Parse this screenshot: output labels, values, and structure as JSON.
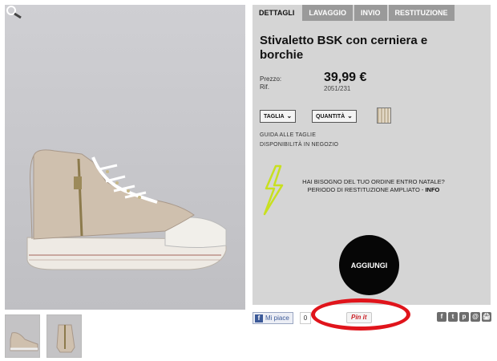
{
  "tabs": [
    {
      "label": "DETTAGLI",
      "active": true
    },
    {
      "label": "LAVAGGIO",
      "active": false
    },
    {
      "label": "INVIO",
      "active": false
    },
    {
      "label": "RESTITUZIONE",
      "active": false
    }
  ],
  "product": {
    "title": "Stivaletto BSK con cerniera e borchie",
    "price_label": "Prezzo:",
    "price": "39,99 €",
    "ref_label": "Rif.",
    "ref": "2051/231"
  },
  "selectors": {
    "size_label": "TAGLIA",
    "quantity_label": "QUANTITÀ",
    "chevron": "⌄"
  },
  "links": {
    "size_guide": "GUIDA ALLE TAGLIE",
    "store_availability": "DISPONIBILITÀ IN NEGOZIO"
  },
  "notice": {
    "line1": "HAI BISOGNO DEL TUO ORDINE ENTRO NATALE?",
    "line2": "PERIODO DI RESTITUZIONE AMPLIATO - ",
    "info": "INFO"
  },
  "cart": {
    "add_label": "AGGIUNGI"
  },
  "social": {
    "fb_label": "Mi piace",
    "fb_icon": "f",
    "fb_count": "0",
    "pin_label": "Pin it",
    "share_icons": [
      "f",
      "t",
      "p",
      "@",
      "🖨"
    ]
  },
  "colors": {
    "panel_bg": "#d5d5d5",
    "tab_inactive": "#9a9a9a",
    "add_button": "#060606",
    "highlight_ring": "#e0141b",
    "notice_bolt": "#c8e020"
  },
  "icons": {
    "zoom": "magnifier-icon",
    "notice": "lightning-bolt-icon",
    "swatch": "color-swatch"
  }
}
